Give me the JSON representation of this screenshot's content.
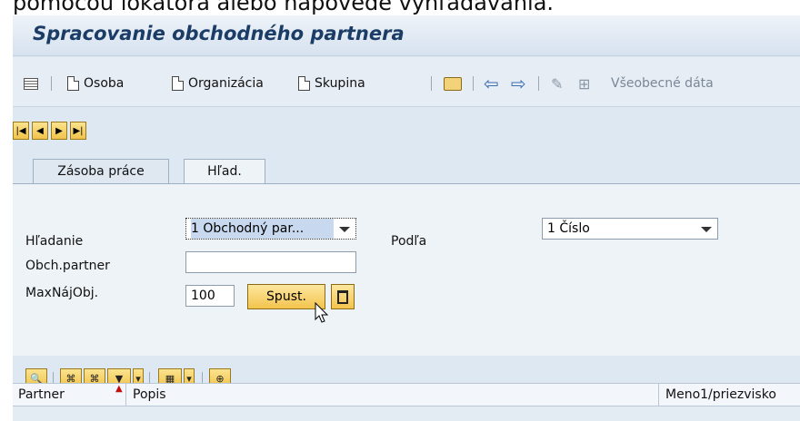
{
  "caption": "pomocou lokátora alebo nápovede vyhľadávania.",
  "window": {
    "title": "Spracovanie obchodného partnera"
  },
  "toolbar": {
    "person_label": "Osoba",
    "organization_label": "Organizácia",
    "group_label": "Skupina",
    "general_data_label": "Všeobecné dáta",
    "icons": [
      "list-icon",
      "document-icon",
      "open-folder-icon",
      "arrow-left-icon",
      "arrow-right-icon",
      "pen-icon",
      "tree-icon"
    ]
  },
  "tabs": [
    {
      "label": "Zásoba práce",
      "active": false
    },
    {
      "label": "Hľad.",
      "active": true
    }
  ],
  "form": {
    "search_label": "Hľadanie",
    "search_value": "1 Obchodný par...",
    "by_label": "Podľa",
    "by_value": "1 Číslo",
    "partner_label": "Obch.partner",
    "partner_value": "",
    "max_label": "MaxNájObj.",
    "max_value": "100",
    "execute_label": "Spust."
  },
  "grid": {
    "columns": [
      "Partner",
      "Popis",
      "Meno1/priezvisko"
    ]
  },
  "colors": {
    "accent_title": "#1a3c66",
    "button_yellow": "#f3c44d",
    "panel_bg": "#eef3f8"
  }
}
